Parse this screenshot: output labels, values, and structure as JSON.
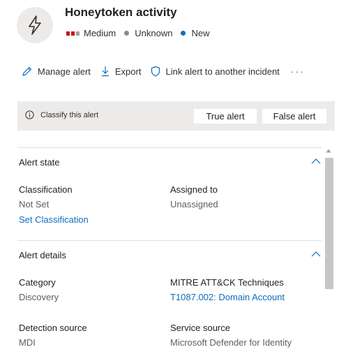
{
  "header": {
    "icon": "lightning-bolt-icon",
    "title": "Honeytoken activity",
    "severity": {
      "label": "Medium",
      "bars_color": "#c50f1f",
      "bar_off_color": "#a19f9d"
    },
    "determination": {
      "label": "Unknown",
      "dot_color": "#8a8886"
    },
    "status": {
      "label": "New",
      "dot_color": "#0f6cbd"
    }
  },
  "toolbar": {
    "manage_label": "Manage alert",
    "export_label": "Export",
    "link_label": "Link alert to another incident",
    "more_label": "···"
  },
  "classify": {
    "text": "Classify this alert",
    "true_label": "True alert",
    "false_label": "False alert"
  },
  "alert_state": {
    "title": "Alert state",
    "classification_label": "Classification",
    "classification_value": "Not Set",
    "set_link": "Set Classification",
    "assigned_label": "Assigned to",
    "assigned_value": "Unassigned"
  },
  "alert_details": {
    "title": "Alert details",
    "category_label": "Category",
    "category_value": "Discovery",
    "mitre_label": "MITRE ATT&CK Techniques",
    "mitre_value": "T1087.002: Domain Account",
    "detection_label": "Detection source",
    "detection_value": "MDI",
    "service_label": "Service source",
    "service_value": "Microsoft Defender for Identity"
  },
  "colors": {
    "accent": "#0f6cbd",
    "panel": "#edebe9"
  }
}
